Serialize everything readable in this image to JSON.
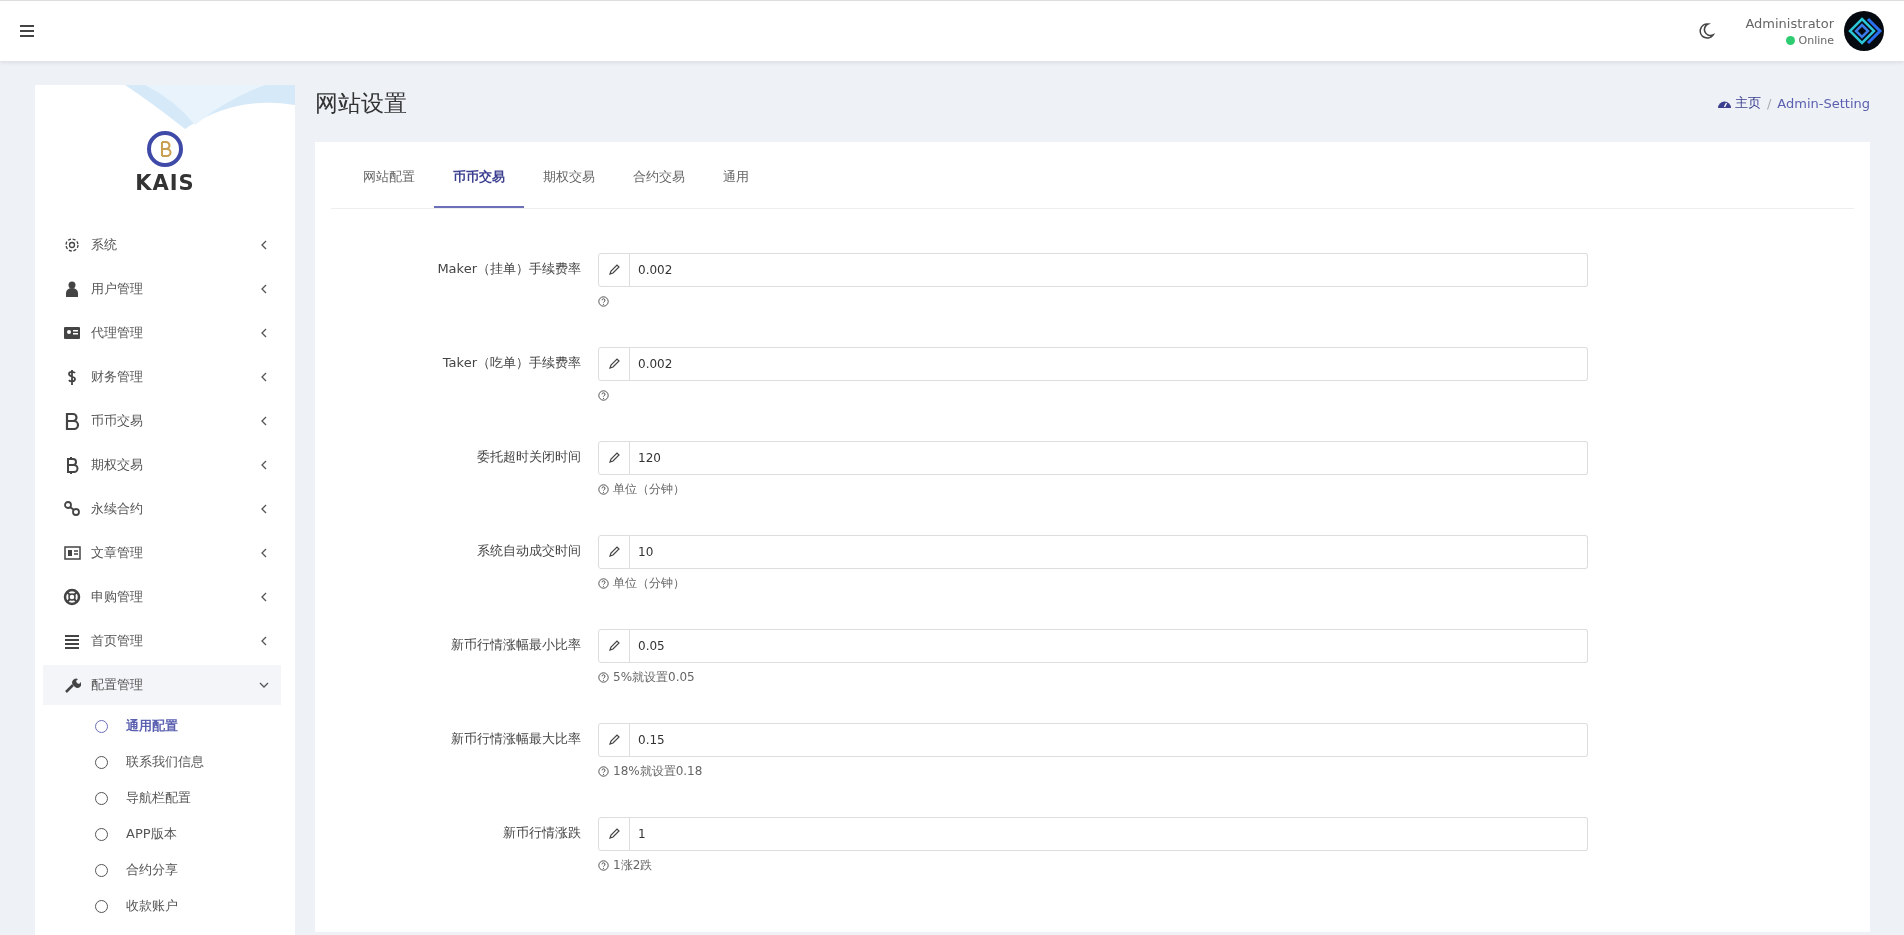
{
  "header": {
    "user_name": "Administrator",
    "status": "Online"
  },
  "sidebar": {
    "brand": "KAIS",
    "items": [
      {
        "label": "系统",
        "expanded": false
      },
      {
        "label": "用户管理",
        "expanded": false
      },
      {
        "label": "代理管理",
        "expanded": false
      },
      {
        "label": "财务管理",
        "expanded": false
      },
      {
        "label": "币币交易",
        "expanded": false
      },
      {
        "label": "期权交易",
        "expanded": false
      },
      {
        "label": "永续合约",
        "expanded": false
      },
      {
        "label": "文章管理",
        "expanded": false
      },
      {
        "label": "申购管理",
        "expanded": false
      },
      {
        "label": "首页管理",
        "expanded": false
      },
      {
        "label": "配置管理",
        "expanded": true,
        "children": [
          {
            "label": "通用配置",
            "selected": true
          },
          {
            "label": "联系我们信息",
            "selected": false
          },
          {
            "label": "导航栏配置",
            "selected": false
          },
          {
            "label": "APP版本",
            "selected": false
          },
          {
            "label": "合约分享",
            "selected": false
          },
          {
            "label": "收款账户",
            "selected": false
          }
        ]
      }
    ]
  },
  "page": {
    "title": "网站设置",
    "breadcrumb": [
      "主页",
      "Admin-Setting"
    ],
    "breadcrumb_separator": "/"
  },
  "tabs": [
    {
      "label": "网站配置",
      "selected": false
    },
    {
      "label": "币币交易",
      "selected": true
    },
    {
      "label": "期权交易",
      "selected": false
    },
    {
      "label": "合约交易",
      "selected": false
    },
    {
      "label": "通用",
      "selected": false
    }
  ],
  "fields": [
    {
      "label": "Maker（挂单）手续费率",
      "value": "0.002"
    },
    {
      "label": "Taker（吃单）手续费率",
      "value": "0.002"
    },
    {
      "label": "委托超时关闭时间",
      "value": "120",
      "help": "单位（分钟）"
    },
    {
      "label": "系统自动成交时间",
      "value": "10",
      "help": "单位（分钟）"
    },
    {
      "label": "新币行情涨幅最小比率",
      "value": "0.05",
      "help": "5%就设置0.05"
    },
    {
      "label": "新币行情涨幅最大比率",
      "value": "0.15",
      "help": "18%就设置0.18"
    },
    {
      "label": "新币行情涨跌",
      "value": "1",
      "help": "1涨2跌"
    }
  ]
}
